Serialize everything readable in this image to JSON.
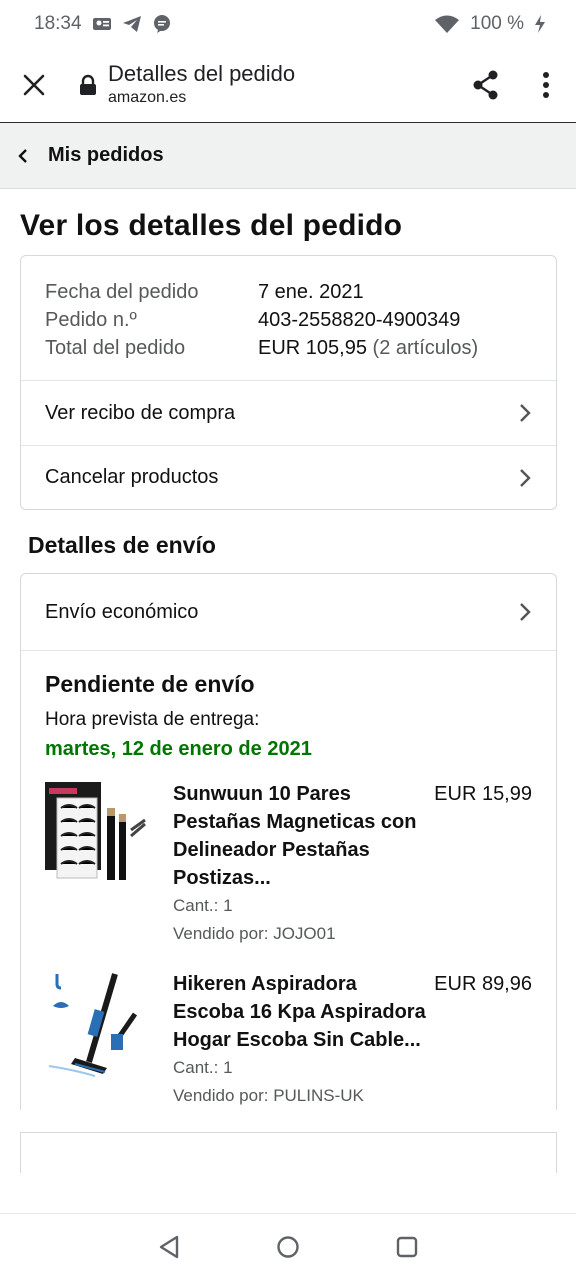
{
  "status_bar": {
    "time": "18:34",
    "battery": "100 %"
  },
  "browser": {
    "title": "Detalles del pedido",
    "domain": "amazon.es"
  },
  "nav": {
    "back_label": "Mis pedidos"
  },
  "page": {
    "title": "Ver los detalles del pedido"
  },
  "order": {
    "date_label": "Fecha del pedido",
    "date_value": "7 ene. 2021",
    "number_label": "Pedido n.º",
    "number_value": "403-2558820-4900349",
    "total_label": "Total del pedido",
    "total_value": "EUR 105,95",
    "total_items": "(2 artículos)"
  },
  "actions": {
    "receipt": "Ver recibo de compra",
    "cancel": "Cancelar productos"
  },
  "shipping": {
    "section_title": "Detalles de envío",
    "method": "Envío económico",
    "status": "Pendiente de envío",
    "eta_label": "Hora prevista de entrega:",
    "eta_date": "martes, 12 de enero de 2021"
  },
  "items": [
    {
      "name": "Sunwuun 10 Pares Pestañas Magneticas con Delineador Pestañas Postizas...",
      "qty": "Cant.: 1",
      "seller": "Vendido por: JOJO01",
      "price": "EUR 15,99"
    },
    {
      "name": "Hikeren Aspiradora Escoba 16 Kpa Aspiradora Hogar Escoba Sin Cable...",
      "qty": "Cant.: 1",
      "seller": "Vendido por: PULINS-UK",
      "price": "EUR 89,96"
    }
  ],
  "colors": {
    "accent_green": "#007600",
    "muted": "#565959",
    "header_bg": "#f0f2f2"
  }
}
